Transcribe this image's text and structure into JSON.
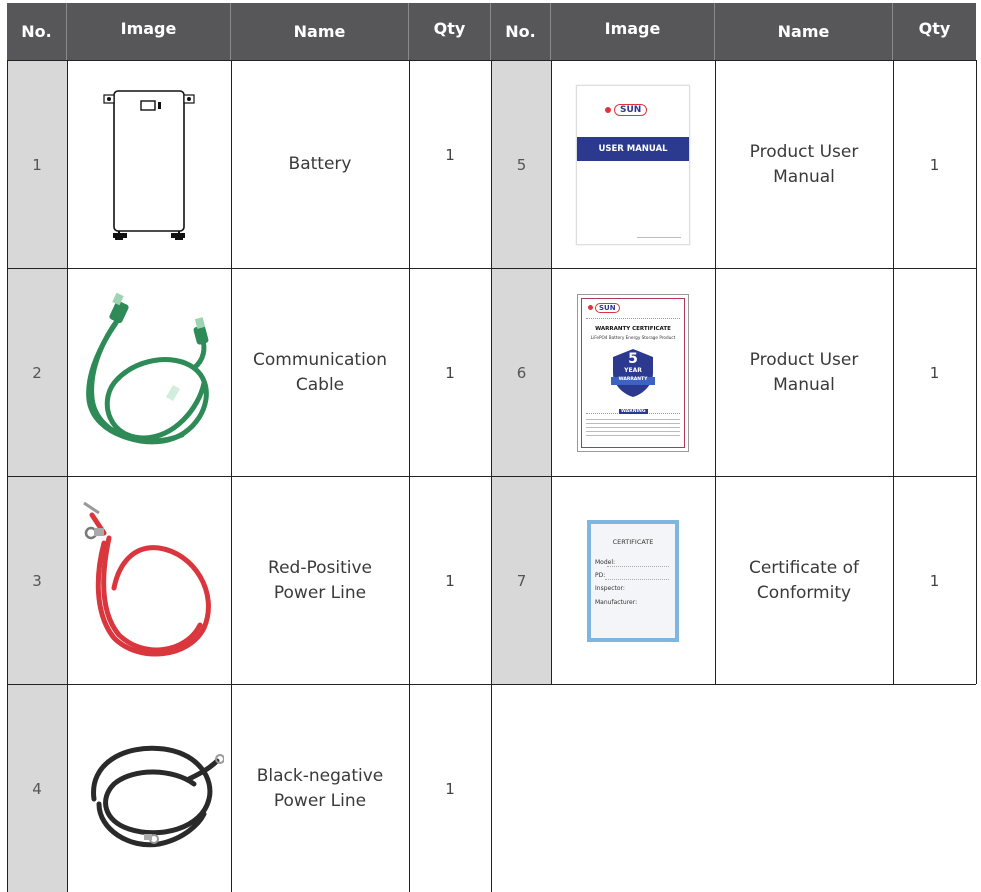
{
  "header": {
    "no": "No.",
    "image": "Image",
    "name": "Name",
    "qty": "Qty"
  },
  "left_rows": [
    {
      "no": "1",
      "name_line1": "Battery",
      "name_line2": "",
      "qty": "1",
      "image": "battery-pack-icon"
    },
    {
      "no": "2",
      "name_line1": "Communication",
      "name_line2": "Cable",
      "qty": "1",
      "image": "green-ethernet-cable-icon"
    },
    {
      "no": "3",
      "name_line1": "Red-Positive",
      "name_line2": "Power Line",
      "qty": "1",
      "image": "red-power-cable-icon"
    },
    {
      "no": "4",
      "name_line1": "Black-negative",
      "name_line2": "Power Line",
      "qty": "1",
      "image": "black-power-cable-icon"
    }
  ],
  "right_rows": [
    {
      "no": "5",
      "name_line1": "Product User",
      "name_line2": "Manual",
      "qty": "1",
      "image": "user-manual-booklet-icon"
    },
    {
      "no": "6",
      "name_line1": "Product User",
      "name_line2": "Manual",
      "qty": "1",
      "image": "warranty-certificate-icon"
    },
    {
      "no": "7",
      "name_line1": "Certificate of",
      "name_line2": "Conformity",
      "qty": "1",
      "image": "conformity-certificate-icon"
    }
  ],
  "images": {
    "manual": {
      "brand": "SUN",
      "banner": "USER MANUAL"
    },
    "warranty": {
      "brand": "SUN",
      "title": "WARRANTY CERTIFICATE",
      "subtitle": "LiFePO4 Battery Energy Storage Product",
      "years": "5",
      "year_label": "YEAR",
      "ribbon": "WARRANTY",
      "warning": "WARNING"
    },
    "certificate": {
      "title": "CERTIFICATE",
      "fields": [
        "Model:",
        "PD:",
        "Inspector:",
        "Manufacturer:"
      ]
    }
  },
  "colors": {
    "header_bg": "#57575a",
    "number_col_bg": "#d8d8d9",
    "manual_banner": "#2b3a8f",
    "cable_green": "#2e8b57",
    "cable_red": "#d9363e",
    "cable_black": "#2a2a2a",
    "certificate_border": "#7fb6e0"
  }
}
